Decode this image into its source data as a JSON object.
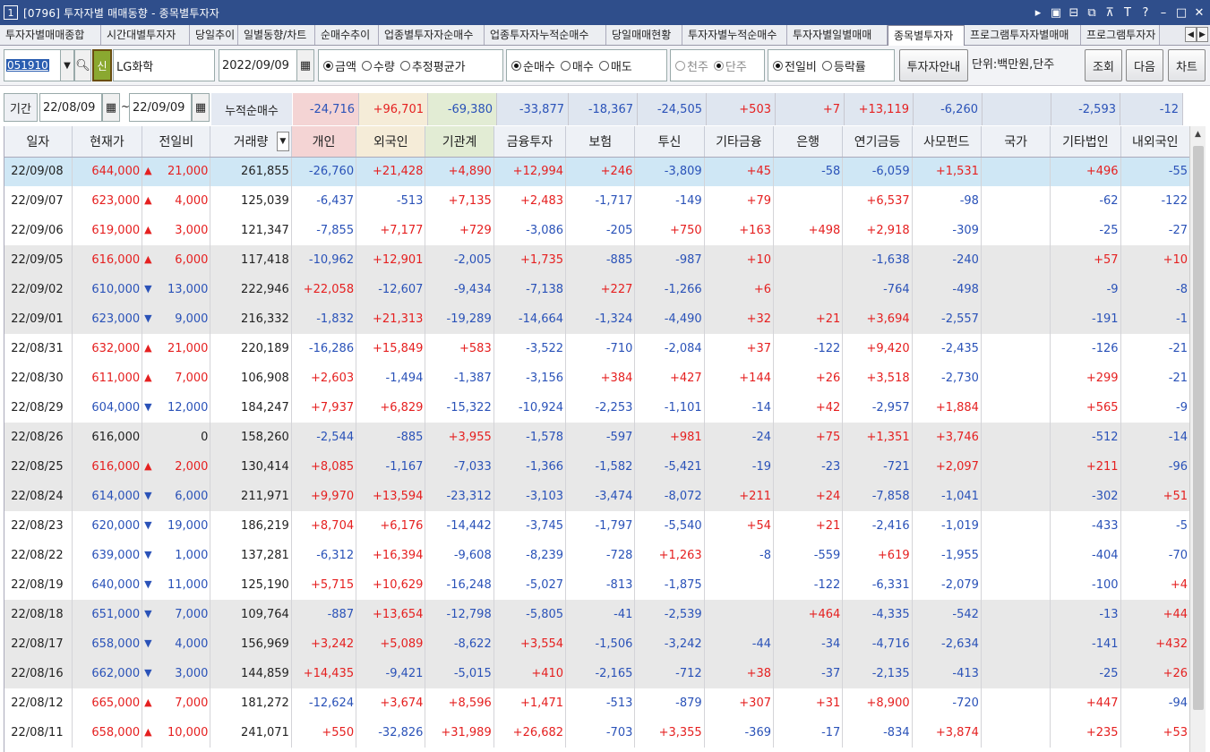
{
  "window": {
    "title": "[0796] 투자자별 매매동향 - 종목별투자자",
    "badge": "1"
  },
  "tabs": [
    "투자자별매매종합",
    "시간대별투자자",
    "당일추이",
    "일별동향/차트",
    "순매수추이",
    "업종별투자자순매수",
    "업종투자자누적순매수",
    "당일매매현황",
    "투자자별누적순매수",
    "투자자별일별매매",
    "종목별투자자",
    "프로그램투자자별매매",
    "프로그램투자자"
  ],
  "active_tab": "종목별투자자",
  "toolbar": {
    "code": "051910",
    "sin_label": "신",
    "stock_name": "LG화학",
    "date": "2022/09/09",
    "radios1": [
      {
        "label": "금액",
        "on": true
      },
      {
        "label": "수량",
        "on": false
      },
      {
        "label": "추정평균가",
        "on": false
      }
    ],
    "radios2": [
      {
        "label": "순매수",
        "on": true
      },
      {
        "label": "매수",
        "on": false
      },
      {
        "label": "매도",
        "on": false
      }
    ],
    "radios3": [
      {
        "label": "천주",
        "on": false
      },
      {
        "label": "단주",
        "on": true
      }
    ],
    "radios4": [
      {
        "label": "전일비",
        "on": true
      },
      {
        "label": "등락률",
        "on": false
      }
    ],
    "guide_btn": "투자자안내",
    "unit": "단위:백만원,단주",
    "query_btn": "조회",
    "next_btn": "다음",
    "chart_btn": "차트"
  },
  "period": {
    "label": "기간",
    "from": "22/08/09",
    "tilde": "~",
    "to": "22/09/09",
    "acc_label": "누적순매수"
  },
  "accum": [
    {
      "v": "-24,716",
      "c": "b",
      "bg": "#f4d4d4"
    },
    {
      "v": "+96,701",
      "c": "r",
      "bg": "#f5ecd8"
    },
    {
      "v": "-69,380",
      "c": "b",
      "bg": "#e2ecd4"
    },
    {
      "v": "-33,877",
      "c": "b",
      "bg": "#dfe6f0"
    },
    {
      "v": "-18,367",
      "c": "b",
      "bg": "#dfe6f0"
    },
    {
      "v": "-24,505",
      "c": "b",
      "bg": "#dfe6f0"
    },
    {
      "v": "+503",
      "c": "r",
      "bg": "#dfe6f0"
    },
    {
      "v": "+7",
      "c": "r",
      "bg": "#dfe6f0"
    },
    {
      "v": "+13,119",
      "c": "r",
      "bg": "#dfe6f0"
    },
    {
      "v": "-6,260",
      "c": "b",
      "bg": "#dfe6f0"
    },
    {
      "v": "",
      "c": "k",
      "bg": "#dfe6f0"
    },
    {
      "v": "-2,593",
      "c": "b",
      "bg": "#dfe6f0"
    },
    {
      "v": "-12",
      "c": "b",
      "bg": "#dfe6f0"
    }
  ],
  "columns": [
    "일자",
    "현재가",
    "전일비",
    "거래량",
    "개인",
    "외국인",
    "기관계",
    "금융투자",
    "보험",
    "투신",
    "기타금융",
    "은행",
    "연기금등",
    "사모펀드",
    "국가",
    "기타법인",
    "내외국인"
  ],
  "sort_arrow": "▼",
  "rows": [
    {
      "d": "22/09/08",
      "p": "644,000",
      "dir": "up",
      "chg": "21,000",
      "vol": "261,855",
      "v": [
        "-26,760",
        "+21,428",
        "+4,890",
        "+12,994",
        "+246",
        "-3,809",
        "+45",
        "-58",
        "-6,059",
        "+1,531",
        "",
        "+496",
        "-55"
      ],
      "style": "sel"
    },
    {
      "d": "22/09/07",
      "p": "623,000",
      "dir": "up",
      "chg": "4,000",
      "vol": "125,039",
      "v": [
        "-6,437",
        "-513",
        "+7,135",
        "+2,483",
        "-1,717",
        "-149",
        "+79",
        "",
        "+6,537",
        "-98",
        "",
        "-62",
        "-122"
      ],
      "style": ""
    },
    {
      "d": "22/09/06",
      "p": "619,000",
      "dir": "up",
      "chg": "3,000",
      "vol": "121,347",
      "v": [
        "-7,855",
        "+7,177",
        "+729",
        "-3,086",
        "-205",
        "+750",
        "+163",
        "+498",
        "+2,918",
        "-309",
        "",
        "-25",
        "-27"
      ],
      "style": ""
    },
    {
      "d": "22/09/05",
      "p": "616,000",
      "dir": "up",
      "chg": "6,000",
      "vol": "117,418",
      "v": [
        "-10,962",
        "+12,901",
        "-2,005",
        "+1,735",
        "-885",
        "-987",
        "+10",
        "",
        "-1,638",
        "-240",
        "",
        "+57",
        "+10"
      ],
      "style": "g"
    },
    {
      "d": "22/09/02",
      "p": "610,000",
      "dir": "dn",
      "chg": "13,000",
      "vol": "222,946",
      "v": [
        "+22,058",
        "-12,607",
        "-9,434",
        "-7,138",
        "+227",
        "-1,266",
        "+6",
        "",
        "-764",
        "-498",
        "",
        "-9",
        "-8"
      ],
      "style": "g"
    },
    {
      "d": "22/09/01",
      "p": "623,000",
      "dir": "dn",
      "chg": "9,000",
      "vol": "216,332",
      "v": [
        "-1,832",
        "+21,313",
        "-19,289",
        "-14,664",
        "-1,324",
        "-4,490",
        "+32",
        "+21",
        "+3,694",
        "-2,557",
        "",
        "-191",
        "-1"
      ],
      "style": "g"
    },
    {
      "d": "22/08/31",
      "p": "632,000",
      "dir": "up",
      "chg": "21,000",
      "vol": "220,189",
      "v": [
        "-16,286",
        "+15,849",
        "+583",
        "-3,522",
        "-710",
        "-2,084",
        "+37",
        "-122",
        "+9,420",
        "-2,435",
        "",
        "-126",
        "-21"
      ],
      "style": ""
    },
    {
      "d": "22/08/30",
      "p": "611,000",
      "dir": "up",
      "chg": "7,000",
      "vol": "106,908",
      "v": [
        "+2,603",
        "-1,494",
        "-1,387",
        "-3,156",
        "+384",
        "+427",
        "+144",
        "+26",
        "+3,518",
        "-2,730",
        "",
        "+299",
        "-21"
      ],
      "style": ""
    },
    {
      "d": "22/08/29",
      "p": "604,000",
      "dir": "dn",
      "chg": "12,000",
      "vol": "184,247",
      "v": [
        "+7,937",
        "+6,829",
        "-15,322",
        "-10,924",
        "-2,253",
        "-1,101",
        "-14",
        "+42",
        "-2,957",
        "+1,884",
        "",
        "+565",
        "-9"
      ],
      "style": ""
    },
    {
      "d": "22/08/26",
      "p": "616,000",
      "dir": "",
      "chg": "0",
      "vol": "158,260",
      "v": [
        "-2,544",
        "-885",
        "+3,955",
        "-1,578",
        "-597",
        "+981",
        "-24",
        "+75",
        "+1,351",
        "+3,746",
        "",
        "-512",
        "-14"
      ],
      "style": "g"
    },
    {
      "d": "22/08/25",
      "p": "616,000",
      "dir": "up",
      "chg": "2,000",
      "vol": "130,414",
      "v": [
        "+8,085",
        "-1,167",
        "-7,033",
        "-1,366",
        "-1,582",
        "-5,421",
        "-19",
        "-23",
        "-721",
        "+2,097",
        "",
        "+211",
        "-96"
      ],
      "style": "g"
    },
    {
      "d": "22/08/24",
      "p": "614,000",
      "dir": "dn",
      "chg": "6,000",
      "vol": "211,971",
      "v": [
        "+9,970",
        "+13,594",
        "-23,312",
        "-3,103",
        "-3,474",
        "-8,072",
        "+211",
        "+24",
        "-7,858",
        "-1,041",
        "",
        "-302",
        "+51"
      ],
      "style": "g"
    },
    {
      "d": "22/08/23",
      "p": "620,000",
      "dir": "dn",
      "chg": "19,000",
      "vol": "186,219",
      "v": [
        "+8,704",
        "+6,176",
        "-14,442",
        "-3,745",
        "-1,797",
        "-5,540",
        "+54",
        "+21",
        "-2,416",
        "-1,019",
        "",
        "-433",
        "-5"
      ],
      "style": ""
    },
    {
      "d": "22/08/22",
      "p": "639,000",
      "dir": "dn",
      "chg": "1,000",
      "vol": "137,281",
      "v": [
        "-6,312",
        "+16,394",
        "-9,608",
        "-8,239",
        "-728",
        "+1,263",
        "-8",
        "-559",
        "+619",
        "-1,955",
        "",
        "-404",
        "-70"
      ],
      "style": ""
    },
    {
      "d": "22/08/19",
      "p": "640,000",
      "dir": "dn",
      "chg": "11,000",
      "vol": "125,190",
      "v": [
        "+5,715",
        "+10,629",
        "-16,248",
        "-5,027",
        "-813",
        "-1,875",
        "",
        "-122",
        "-6,331",
        "-2,079",
        "",
        "-100",
        "+4"
      ],
      "style": ""
    },
    {
      "d": "22/08/18",
      "p": "651,000",
      "dir": "dn",
      "chg": "7,000",
      "vol": "109,764",
      "v": [
        "-887",
        "+13,654",
        "-12,798",
        "-5,805",
        "-41",
        "-2,539",
        "",
        "+464",
        "-4,335",
        "-542",
        "",
        "-13",
        "+44"
      ],
      "style": "g"
    },
    {
      "d": "22/08/17",
      "p": "658,000",
      "dir": "dn",
      "chg": "4,000",
      "vol": "156,969",
      "v": [
        "+3,242",
        "+5,089",
        "-8,622",
        "+3,554",
        "-1,506",
        "-3,242",
        "-44",
        "-34",
        "-4,716",
        "-2,634",
        "",
        "-141",
        "+432"
      ],
      "style": "g"
    },
    {
      "d": "22/08/16",
      "p": "662,000",
      "dir": "dn",
      "chg": "3,000",
      "vol": "144,859",
      "v": [
        "+14,435",
        "-9,421",
        "-5,015",
        "+410",
        "-2,165",
        "-712",
        "+38",
        "-37",
        "-2,135",
        "-413",
        "",
        "-25",
        "+26"
      ],
      "style": "g"
    },
    {
      "d": "22/08/12",
      "p": "665,000",
      "dir": "up",
      "chg": "7,000",
      "vol": "181,272",
      "v": [
        "-12,624",
        "+3,674",
        "+8,596",
        "+1,471",
        "-513",
        "-879",
        "+307",
        "+31",
        "+8,900",
        "-720",
        "",
        "+447",
        "-94"
      ],
      "style": ""
    },
    {
      "d": "22/08/11",
      "p": "658,000",
      "dir": "up",
      "chg": "10,000",
      "vol": "241,071",
      "v": [
        "+550",
        "-32,826",
        "+31,989",
        "+26,682",
        "-703",
        "+3,355",
        "-369",
        "-17",
        "-834",
        "+3,874",
        "",
        "+235",
        "+53"
      ],
      "style": ""
    }
  ],
  "colors": {
    "up": "#e52020",
    "down": "#2a52b8",
    "selected_row": "#cfe7f5",
    "grey_row": "#e8e8e8",
    "title_bar": "#2f4e8b"
  }
}
